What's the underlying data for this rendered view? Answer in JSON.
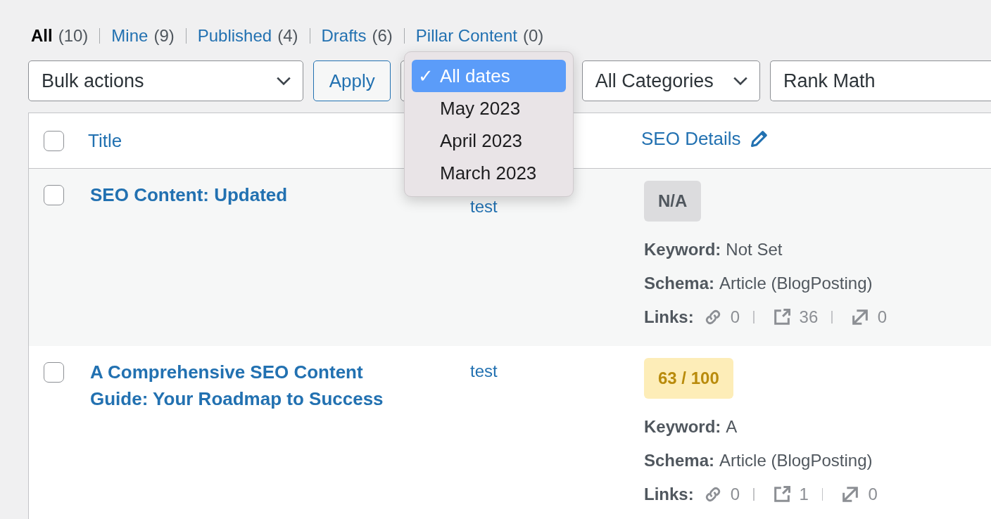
{
  "views": [
    {
      "label": "All",
      "count": "(10)",
      "selected": true
    },
    {
      "label": "Mine",
      "count": "(9)",
      "selected": false
    },
    {
      "label": "Published",
      "count": "(4)",
      "selected": false
    },
    {
      "label": "Drafts",
      "count": "(6)",
      "selected": false
    },
    {
      "label": "Pillar Content",
      "count": "(0)",
      "selected": false
    }
  ],
  "toolbar": {
    "bulk_actions": "Bulk actions",
    "apply": "Apply",
    "categories": "All Categories",
    "search_value": "Rank Math"
  },
  "date_menu": {
    "check": "✓",
    "options": [
      {
        "label": "All dates",
        "selected": true
      },
      {
        "label": "May 2023",
        "selected": false
      },
      {
        "label": "April 2023",
        "selected": false
      },
      {
        "label": "March 2023",
        "selected": false
      }
    ]
  },
  "table": {
    "select_all_checked": false,
    "columns": [
      {
        "label": "Title"
      },
      {
        "label": "SEO Details"
      }
    ],
    "rows": [
      {
        "checked": false,
        "title": "SEO Content: Updated",
        "author": "test",
        "score": {
          "text": "N/A",
          "kind": "none"
        },
        "keyword_label": "Keyword:",
        "keyword": "Not Set",
        "schema_label": "Schema:",
        "schema": "Article (BlogPosting)",
        "links_label": "Links:",
        "internal": "0",
        "external": "36",
        "incoming": "0"
      },
      {
        "checked": false,
        "title": "A Comprehensive SEO Content Guide: Your Roadmap to Success",
        "author": "test",
        "score": {
          "text": "63 / 100",
          "kind": "average"
        },
        "keyword_label": "Keyword:",
        "keyword": "A",
        "schema_label": "Schema:",
        "schema": "Article (BlogPosting)",
        "links_label": "Links:",
        "internal": "0",
        "external": "1",
        "incoming": "0"
      }
    ]
  }
}
